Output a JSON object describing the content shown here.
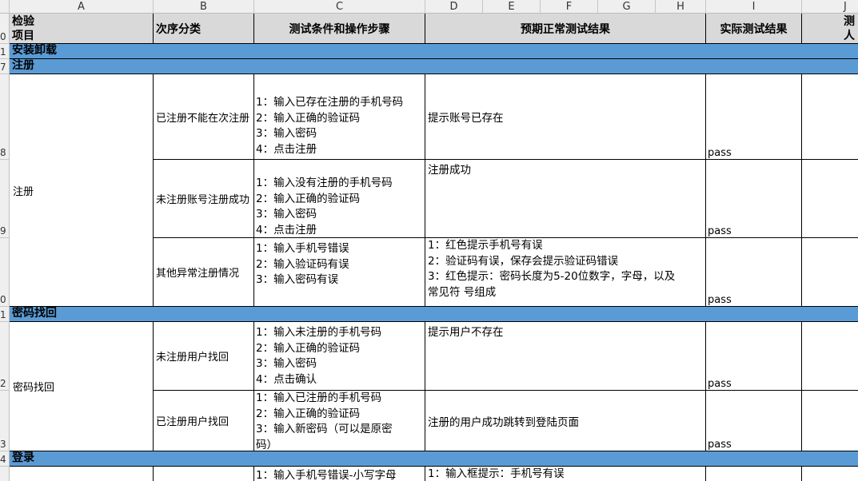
{
  "columns": [
    "A",
    "B",
    "C",
    "D",
    "E",
    "F",
    "G",
    "H",
    "I",
    "J"
  ],
  "row_numbers": [
    "0",
    "1",
    "7",
    "8",
    "9",
    "0",
    "1",
    "2",
    "3",
    "4"
  ],
  "header": {
    "item": "检验\n项目",
    "category": "次序分类",
    "steps": "测试条件和操作步骤",
    "expected": "预期正常测试结果",
    "actual": "实际测试结果",
    "tester": "测\n人"
  },
  "sections": {
    "install": "安装卸载",
    "register": "注册",
    "recover": "密码找回",
    "login": "登录"
  },
  "register": {
    "group_label": "注册",
    "rows": [
      {
        "category": "已注册不能在次注册",
        "steps": "1：输入已存在注册的手机号码\n2：输入正确的验证码\n3：输入密码\n4：点击注册",
        "expected": "提示账号已存在",
        "actual": "pass"
      },
      {
        "category": "未注册账号注册成功",
        "steps": "1：输入没有注册的手机号码\n2：输入正确的验证码\n3：输入密码\n4：点击注册",
        "expected": "注册成功",
        "actual": "pass"
      },
      {
        "category": "其他异常注册情况",
        "steps": "1：输入手机号错误\n2：输入验证码有误\n3：输入密码有误",
        "expected": "1：红色提示手机号有误\n2：验证码有误，保存会提示验证码错误\n3：红色提示：密码长度为5-20位数字，字母，以及\n常见符 号组成",
        "actual": "pass"
      }
    ]
  },
  "recover": {
    "group_label": "密码找回",
    "rows": [
      {
        "category": "未注册用户找回",
        "steps": "1：输入未注册的手机号码\n2：输入正确的验证码\n3：输入密码\n4：点击确认",
        "expected": "提示用户不存在",
        "actual": "pass"
      },
      {
        "category": "已注册用户找回",
        "steps": "1：输入已注册的手机号码\n2：输入正确的验证码\n3：输入新密码（可以是原密\n码）",
        "expected": "注册的用户成功跳转到登陆页面",
        "actual": "pass"
      }
    ]
  },
  "login": {
    "rows": [
      {
        "steps": "1：输入手机号错误-小写字母",
        "expected": "1：输入框提示：手机号有误"
      }
    ]
  }
}
